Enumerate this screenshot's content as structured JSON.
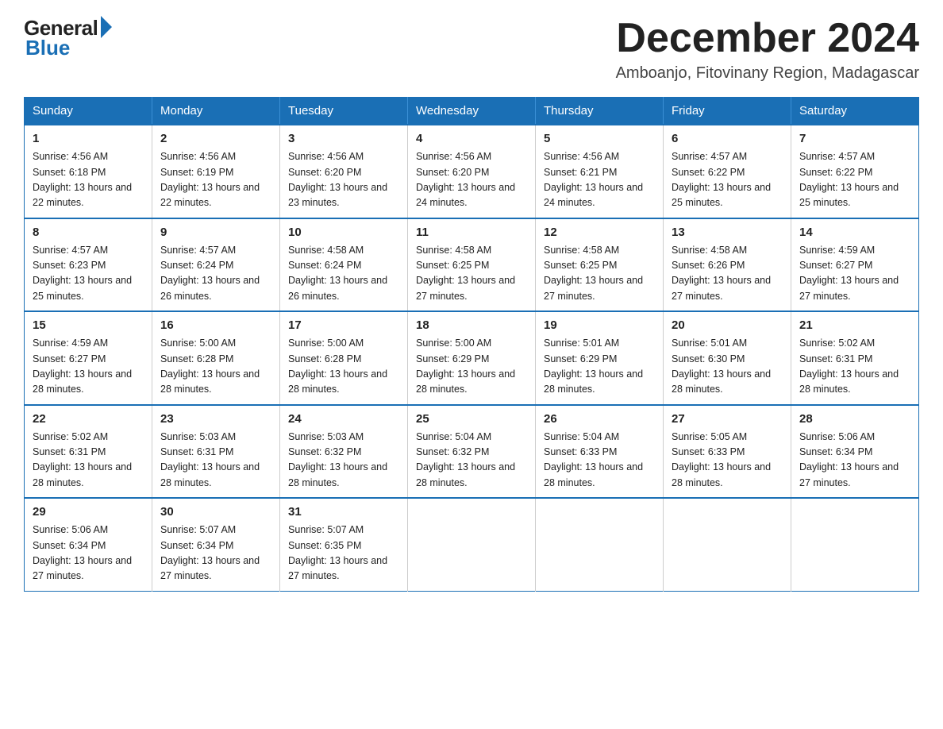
{
  "logo": {
    "general": "General",
    "blue": "Blue"
  },
  "title": "December 2024",
  "location": "Amboanjo, Fitovinany Region, Madagascar",
  "days_of_week": [
    "Sunday",
    "Monday",
    "Tuesday",
    "Wednesday",
    "Thursday",
    "Friday",
    "Saturday"
  ],
  "weeks": [
    [
      {
        "day": "1",
        "sunrise": "4:56 AM",
        "sunset": "6:18 PM",
        "daylight": "13 hours and 22 minutes."
      },
      {
        "day": "2",
        "sunrise": "4:56 AM",
        "sunset": "6:19 PM",
        "daylight": "13 hours and 22 minutes."
      },
      {
        "day": "3",
        "sunrise": "4:56 AM",
        "sunset": "6:20 PM",
        "daylight": "13 hours and 23 minutes."
      },
      {
        "day": "4",
        "sunrise": "4:56 AM",
        "sunset": "6:20 PM",
        "daylight": "13 hours and 24 minutes."
      },
      {
        "day": "5",
        "sunrise": "4:56 AM",
        "sunset": "6:21 PM",
        "daylight": "13 hours and 24 minutes."
      },
      {
        "day": "6",
        "sunrise": "4:57 AM",
        "sunset": "6:22 PM",
        "daylight": "13 hours and 25 minutes."
      },
      {
        "day": "7",
        "sunrise": "4:57 AM",
        "sunset": "6:22 PM",
        "daylight": "13 hours and 25 minutes."
      }
    ],
    [
      {
        "day": "8",
        "sunrise": "4:57 AM",
        "sunset": "6:23 PM",
        "daylight": "13 hours and 25 minutes."
      },
      {
        "day": "9",
        "sunrise": "4:57 AM",
        "sunset": "6:24 PM",
        "daylight": "13 hours and 26 minutes."
      },
      {
        "day": "10",
        "sunrise": "4:58 AM",
        "sunset": "6:24 PM",
        "daylight": "13 hours and 26 minutes."
      },
      {
        "day": "11",
        "sunrise": "4:58 AM",
        "sunset": "6:25 PM",
        "daylight": "13 hours and 27 minutes."
      },
      {
        "day": "12",
        "sunrise": "4:58 AM",
        "sunset": "6:25 PM",
        "daylight": "13 hours and 27 minutes."
      },
      {
        "day": "13",
        "sunrise": "4:58 AM",
        "sunset": "6:26 PM",
        "daylight": "13 hours and 27 minutes."
      },
      {
        "day": "14",
        "sunrise": "4:59 AM",
        "sunset": "6:27 PM",
        "daylight": "13 hours and 27 minutes."
      }
    ],
    [
      {
        "day": "15",
        "sunrise": "4:59 AM",
        "sunset": "6:27 PM",
        "daylight": "13 hours and 28 minutes."
      },
      {
        "day": "16",
        "sunrise": "5:00 AM",
        "sunset": "6:28 PM",
        "daylight": "13 hours and 28 minutes."
      },
      {
        "day": "17",
        "sunrise": "5:00 AM",
        "sunset": "6:28 PM",
        "daylight": "13 hours and 28 minutes."
      },
      {
        "day": "18",
        "sunrise": "5:00 AM",
        "sunset": "6:29 PM",
        "daylight": "13 hours and 28 minutes."
      },
      {
        "day": "19",
        "sunrise": "5:01 AM",
        "sunset": "6:29 PM",
        "daylight": "13 hours and 28 minutes."
      },
      {
        "day": "20",
        "sunrise": "5:01 AM",
        "sunset": "6:30 PM",
        "daylight": "13 hours and 28 minutes."
      },
      {
        "day": "21",
        "sunrise": "5:02 AM",
        "sunset": "6:31 PM",
        "daylight": "13 hours and 28 minutes."
      }
    ],
    [
      {
        "day": "22",
        "sunrise": "5:02 AM",
        "sunset": "6:31 PM",
        "daylight": "13 hours and 28 minutes."
      },
      {
        "day": "23",
        "sunrise": "5:03 AM",
        "sunset": "6:31 PM",
        "daylight": "13 hours and 28 minutes."
      },
      {
        "day": "24",
        "sunrise": "5:03 AM",
        "sunset": "6:32 PM",
        "daylight": "13 hours and 28 minutes."
      },
      {
        "day": "25",
        "sunrise": "5:04 AM",
        "sunset": "6:32 PM",
        "daylight": "13 hours and 28 minutes."
      },
      {
        "day": "26",
        "sunrise": "5:04 AM",
        "sunset": "6:33 PM",
        "daylight": "13 hours and 28 minutes."
      },
      {
        "day": "27",
        "sunrise": "5:05 AM",
        "sunset": "6:33 PM",
        "daylight": "13 hours and 28 minutes."
      },
      {
        "day": "28",
        "sunrise": "5:06 AM",
        "sunset": "6:34 PM",
        "daylight": "13 hours and 27 minutes."
      }
    ],
    [
      {
        "day": "29",
        "sunrise": "5:06 AM",
        "sunset": "6:34 PM",
        "daylight": "13 hours and 27 minutes."
      },
      {
        "day": "30",
        "sunrise": "5:07 AM",
        "sunset": "6:34 PM",
        "daylight": "13 hours and 27 minutes."
      },
      {
        "day": "31",
        "sunrise": "5:07 AM",
        "sunset": "6:35 PM",
        "daylight": "13 hours and 27 minutes."
      },
      null,
      null,
      null,
      null
    ]
  ]
}
